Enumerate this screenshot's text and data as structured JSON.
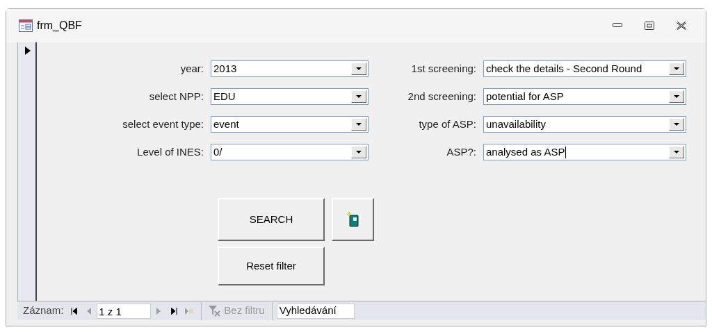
{
  "window": {
    "title": "frm_QBF"
  },
  "left_fields": [
    {
      "label": "year:",
      "value": "2013",
      "focused": false
    },
    {
      "label": "select NPP:",
      "value": "EDU",
      "focused": false
    },
    {
      "label": "select event type:",
      "value": "event",
      "focused": false
    },
    {
      "label": "Level of INES:",
      "value": "0/",
      "focused": false
    }
  ],
  "right_fields": [
    {
      "label": "1st screening:",
      "value": "check the details - Second Round",
      "focused": false
    },
    {
      "label": "2nd screening:",
      "value": "potential for ASP",
      "focused": false
    },
    {
      "label": "type of ASP:",
      "value": "unavailability",
      "focused": false
    },
    {
      "label": "ASP?:",
      "value": "analysed as ASP",
      "focused": true
    }
  ],
  "buttons": [
    {
      "kind": "text",
      "label": "SEARCH"
    },
    {
      "kind": "icon"
    },
    {
      "kind": "text",
      "label": "Reset filter"
    }
  ],
  "navigation": {
    "label": "Záznam:",
    "record": "1 z 1",
    "first_disabled": false,
    "prev_disabled": true,
    "next_disabled": true,
    "last_disabled": false,
    "new_disabled": true,
    "filter": {
      "label": "Bez filtru",
      "disabled": true
    },
    "search": {
      "placeholder": "Vyhledávání"
    }
  }
}
